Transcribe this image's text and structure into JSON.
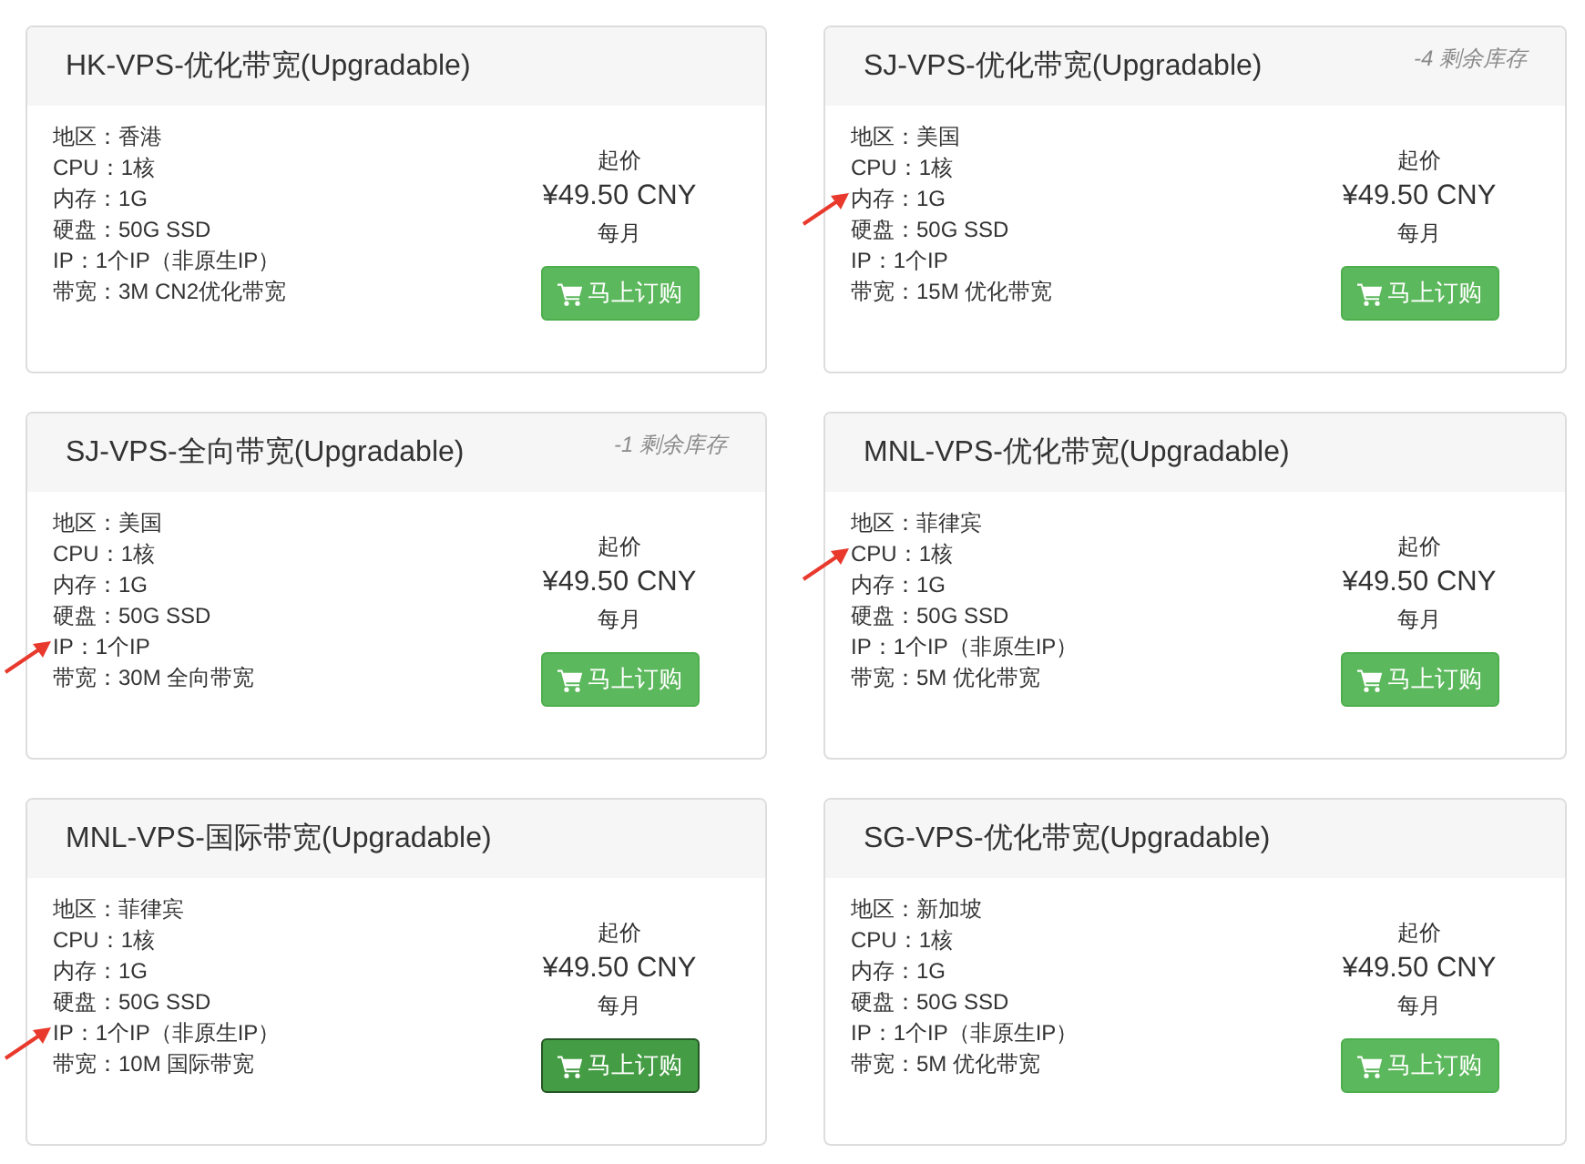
{
  "plans": [
    {
      "title": "HK-VPS-优化带宽(Upgradable)",
      "specs": [
        {
          "text": "地区：香港",
          "marked": false
        },
        {
          "text": "CPU：1核",
          "marked": false
        },
        {
          "text": "内存：1G",
          "marked": false
        },
        {
          "text": "硬盘：50G SSD",
          "marked": false
        },
        {
          "text": "IP：1个IP（非原生IP）",
          "marked": false
        },
        {
          "text": "带宽：3M CN2优化带宽",
          "marked": false
        }
      ],
      "price_label": "起价",
      "price": "¥49.50 CNY",
      "period": "每月",
      "order_button": {
        "label": "马上订购",
        "hovered": false
      }
    },
    {
      "title": "SJ-VPS-优化带宽(Upgradable)",
      "stock": "-4 剩余库存",
      "specs": [
        {
          "text": "地区：美国",
          "marked": false
        },
        {
          "text": "CPU：1核",
          "marked": false
        },
        {
          "text": "内存：1G",
          "marked": true
        },
        {
          "text": "硬盘：50G SSD",
          "marked": false
        },
        {
          "text": "IP：1个IP",
          "marked": false
        },
        {
          "text": "带宽：15M 优化带宽",
          "marked": false
        }
      ],
      "price_label": "起价",
      "price": "¥49.50 CNY",
      "period": "每月",
      "order_button": {
        "label": "马上订购",
        "hovered": false
      }
    },
    {
      "title": "SJ-VPS-全向带宽(Upgradable)",
      "stock": "-1 剩余库存",
      "specs": [
        {
          "text": "地区：美国",
          "marked": false
        },
        {
          "text": "CPU：1核",
          "marked": false
        },
        {
          "text": "内存：1G",
          "marked": false
        },
        {
          "text": "硬盘：50G SSD",
          "marked": false
        },
        {
          "text": "IP：1个IP",
          "marked": true
        },
        {
          "text": "带宽：30M 全向带宽",
          "marked": false
        }
      ],
      "price_label": "起价",
      "price": "¥49.50 CNY",
      "period": "每月",
      "order_button": {
        "label": "马上订购",
        "hovered": false
      }
    },
    {
      "title": "MNL-VPS-优化带宽(Upgradable)",
      "specs": [
        {
          "text": "地区：菲律宾",
          "marked": false
        },
        {
          "text": "CPU：1核",
          "marked": true
        },
        {
          "text": "内存：1G",
          "marked": false
        },
        {
          "text": "硬盘：50G SSD",
          "marked": false
        },
        {
          "text": "IP：1个IP（非原生IP）",
          "marked": false
        },
        {
          "text": "带宽：5M 优化带宽",
          "marked": false
        }
      ],
      "price_label": "起价",
      "price": "¥49.50 CNY",
      "period": "每月",
      "order_button": {
        "label": "马上订购",
        "hovered": false
      }
    },
    {
      "title": "MNL-VPS-国际带宽(Upgradable)",
      "specs": [
        {
          "text": "地区：菲律宾",
          "marked": false
        },
        {
          "text": "CPU：1核",
          "marked": false
        },
        {
          "text": "内存：1G",
          "marked": false
        },
        {
          "text": "硬盘：50G SSD",
          "marked": false
        },
        {
          "text": "IP：1个IP（非原生IP）",
          "marked": true
        },
        {
          "text": "带宽：10M 国际带宽",
          "marked": false
        }
      ],
      "price_label": "起价",
      "price": "¥49.50 CNY",
      "period": "每月",
      "order_button": {
        "label": "马上订购",
        "hovered": true
      }
    },
    {
      "title": "SG-VPS-优化带宽(Upgradable)",
      "specs": [
        {
          "text": "地区：新加坡",
          "marked": false
        },
        {
          "text": "CPU：1核",
          "marked": false
        },
        {
          "text": "内存：1G",
          "marked": false
        },
        {
          "text": "硬盘：50G SSD",
          "marked": false
        },
        {
          "text": "IP：1个IP（非原生IP）",
          "marked": false
        },
        {
          "text": "带宽：5M 优化带宽",
          "marked": false
        }
      ],
      "price_label": "起价",
      "price": "¥49.50 CNY",
      "period": "每月",
      "order_button": {
        "label": "马上订购",
        "hovered": false
      }
    }
  ]
}
